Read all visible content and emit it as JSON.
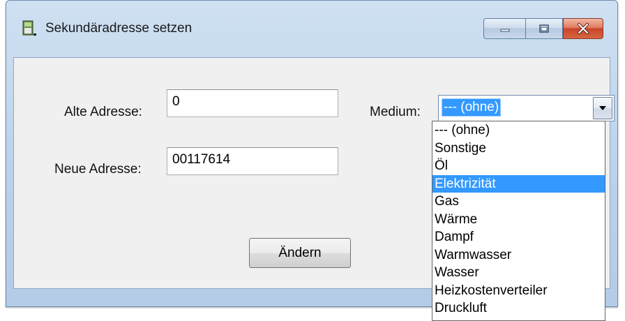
{
  "window": {
    "title": "Sekundäradresse setzen"
  },
  "form": {
    "old_address_label": "Alte Adresse:",
    "old_address_value": "0",
    "new_address_label": "Neue Adresse:",
    "new_address_value": "00117614",
    "medium_label": "Medium:",
    "medium_selected": "--- (ohne)",
    "change_button": "Ändern"
  },
  "medium_options": [
    "--- (ohne)",
    "Sonstige",
    "Öl",
    "Elektrizität",
    "Gas",
    "Wärme",
    "Dampf",
    "Warmwasser",
    "Wasser",
    "Heizkostenverteiler",
    "Druckluft"
  ],
  "highlighted_option": "Elektrizität",
  "colors": {
    "selection": "#3399ff",
    "close_button": "#c8452b"
  }
}
